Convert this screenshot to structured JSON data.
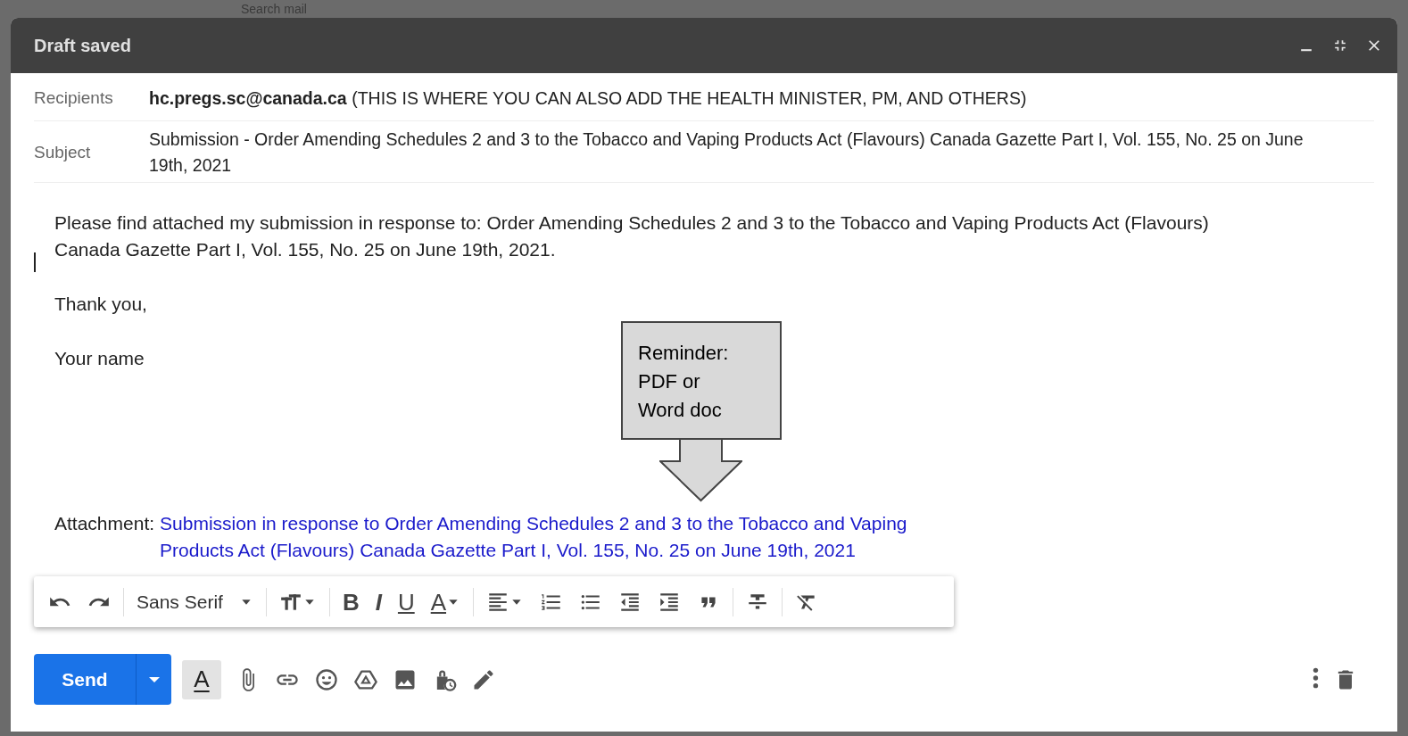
{
  "backdrop": {
    "search_placeholder": "Search mail"
  },
  "window": {
    "title": "Draft saved"
  },
  "recipients": {
    "label": "Recipients",
    "address": "hc.pregs.sc@canada.ca",
    "note": "(THIS IS WHERE YOU CAN ALSO ADD THE HEALTH MINISTER, PM, AND OTHERS)"
  },
  "subject": {
    "label": "Subject",
    "value": "Submission - Order Amending Schedules 2 and 3 to the Tobacco and Vaping Products Act (Flavours) Canada Gazette Part I, Vol. 155, No. 25 on June 19th, 2021"
  },
  "body": {
    "paragraphs": [
      "Please find attached my submission in response to: Order Amending Schedules 2 and 3 to the Tobacco and Vaping Products Act (Flavours) Canada Gazette Part I, Vol. 155, No. 25 on June 19th, 2021.",
      "Thank you,",
      "Your name"
    ],
    "attachment_label": "Attachment:",
    "attachment_link": "Submission in response to Order Amending Schedules 2 and 3 to the Tobacco and Vaping Products Act (Flavours) Canada Gazette Part I, Vol. 155, No. 25 on June 19th, 2021"
  },
  "callout": {
    "text": "Reminder: PDF or Word doc"
  },
  "format_toolbar": {
    "font": "Sans Serif",
    "bold": "B",
    "italic": "I",
    "underline": "U",
    "text_color": "A"
  },
  "bottom_bar": {
    "send": "Send",
    "formatting_toggle": "A",
    "formatting_open": true
  }
}
